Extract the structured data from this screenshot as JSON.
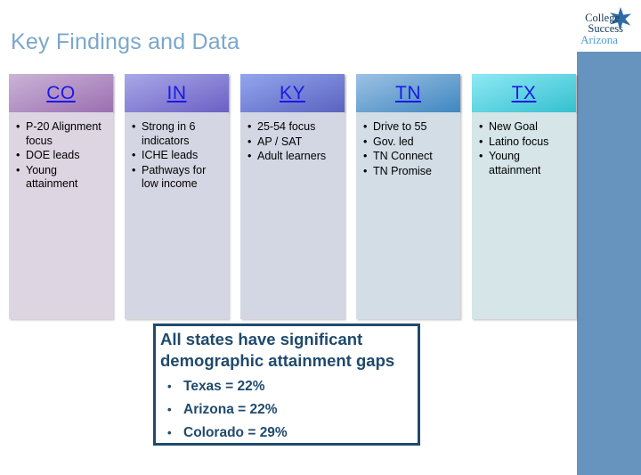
{
  "slide": {
    "title": "Key Findings and Data",
    "title_color": "#7ba7cc",
    "background": "#ffffff",
    "accent_panel_color": "#6694bf"
  },
  "logo": {
    "line1": "College",
    "line2": "Success",
    "line3": "Arizona",
    "star_icon": "star-icon",
    "text_color": "#12395c",
    "subtext_color": "#4f9ed0",
    "star_color": "#2f6ca3"
  },
  "table": {
    "columns": [
      {
        "header": "CO",
        "header_gradient_start": "#cbb4d8",
        "header_gradient_end": "#9b6fb0",
        "body_color": "#ddd6e2",
        "bullet": "•",
        "items": [
          "P-20 Alignment focus",
          "DOE leads",
          "Young attainment"
        ]
      },
      {
        "header": "IN",
        "header_gradient_start": "#a9a9e8",
        "header_gradient_end": "#6b5fc4",
        "body_color": "#d5d6e3",
        "bullet": "•",
        "items": [
          "Strong in 6 indicators",
          "ICHE leads",
          "Pathways for low income"
        ]
      },
      {
        "header": "KY",
        "header_gradient_start": "#93a6ee",
        "header_gradient_end": "#5a63bf",
        "body_color": "#d3d7e4",
        "bullet": "•",
        "items": [
          "25-54 focus",
          "AP / SAT",
          "Adult learners"
        ]
      },
      {
        "header": "TN",
        "header_gradient_start": "#9dc2e4",
        "header_gradient_end": "#3f87c0",
        "body_color": "#d2dde6",
        "bullet": "•",
        "items": [
          "Drive to 55",
          "Gov. led",
          "TN Connect",
          "TN Promise"
        ]
      },
      {
        "header": "TX",
        "header_gradient_start": "#8fe9f5",
        "header_gradient_end": "#35c0cf",
        "body_color": "#d5e5e8",
        "bullet": "•",
        "items": [
          "New Goal",
          "Latino focus",
          "Young attainment"
        ]
      }
    ]
  },
  "callout": {
    "heading": "All states have significant demographic attainment gaps",
    "border_color": "#1f4a6d",
    "text_color": "#1f4a6d",
    "bullet": "•",
    "stats": [
      "Texas = 22%",
      "Arizona = 22%",
      "Colorado = 29%"
    ]
  }
}
